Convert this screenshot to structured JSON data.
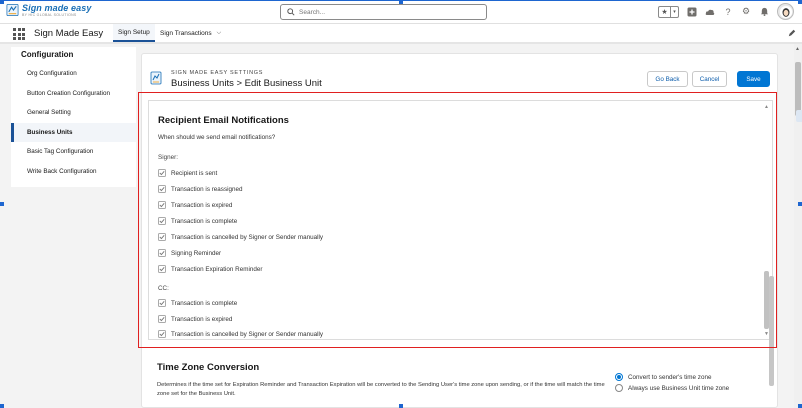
{
  "header": {
    "logo_title": "Sign made easy",
    "logo_subtitle": "BY HIC GLOBAL SOLUTIONS",
    "search_placeholder": "Search..."
  },
  "app_nav": {
    "app_name": "Sign Made Easy",
    "tabs": [
      {
        "label": "Sign Setup",
        "active": true
      },
      {
        "label": "Sign Transactions",
        "active": false
      }
    ]
  },
  "sidebar": {
    "title": "Configuration",
    "items": [
      {
        "label": "Org Configuration",
        "active": false
      },
      {
        "label": "Button Creation Configuration",
        "active": false
      },
      {
        "label": "General Setting",
        "active": false
      },
      {
        "label": "Business Units",
        "active": true
      },
      {
        "label": "Basic Tag Configuration",
        "active": false
      },
      {
        "label": "Write Back Configuration",
        "active": false
      }
    ]
  },
  "page": {
    "breadcrumb": "SIGN MADE EASY SETTINGS",
    "title": "Business Units > Edit Business Unit",
    "buttons": {
      "go_back": "Go Back",
      "cancel": "Cancel",
      "save": "Save"
    }
  },
  "recipient": {
    "title": "Recipient Email Notifications",
    "description": "When should we send email notifications?",
    "signer_label": "Signer:",
    "signer_options": [
      {
        "label": "Recipient is sent",
        "checked": true
      },
      {
        "label": "Transaction is reassigned",
        "checked": true
      },
      {
        "label": "Transaction is expired",
        "checked": true
      },
      {
        "label": "Transaction is complete",
        "checked": true
      },
      {
        "label": "Transaction is cancelled by Signer or Sender manually",
        "checked": true
      },
      {
        "label": "Signing Reminder",
        "checked": true
      },
      {
        "label": "Transaction Expiration Reminder",
        "checked": true
      }
    ],
    "cc_label": "CC:",
    "cc_options": [
      {
        "label": "Transaction is complete",
        "checked": true
      },
      {
        "label": "Transaction is expired",
        "checked": true
      },
      {
        "label": "Transaction is cancelled by Signer or Sender manually",
        "checked": true
      }
    ]
  },
  "timezone": {
    "title": "Time Zone Conversion",
    "description": "Determines if the time set for Expiration Reminder and Transaction Expiration will be converted to the Sending User's time zone upon sending, or if the time will match the time zone set for the Business Unit.",
    "options": [
      {
        "label": "Convert to sender's time zone",
        "checked": true
      },
      {
        "label": "Always use Business Unit time zone",
        "checked": false
      }
    ]
  },
  "colors": {
    "brand": "#0176d3",
    "nav_active": "#1b5297",
    "highlight": "#e02020",
    "selection_frame": "#1e66d0"
  },
  "icons": [
    "search-icon",
    "star-icon",
    "plus-icon",
    "cloud-icon",
    "help-icon",
    "gear-icon",
    "bell-icon",
    "avatar-icon",
    "pencil-icon",
    "checkmark-icon"
  ]
}
